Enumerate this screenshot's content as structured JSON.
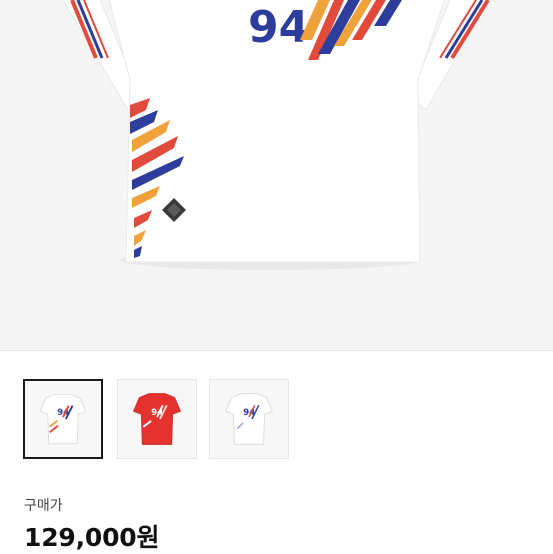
{
  "hero": {
    "jersey_number": "94",
    "background_color": "#f5f5f5",
    "jersey_color": "#ffffff",
    "number_color": "#2d3d9c",
    "accent_colors": [
      "#e24a3b",
      "#2d3d9c",
      "#f0a23a"
    ]
  },
  "thumbnails": [
    {
      "jersey_color": "#ffffff",
      "number": "94",
      "selected": true
    },
    {
      "jersey_color": "#e5322f",
      "number": "94",
      "selected": false
    },
    {
      "jersey_color": "#ffffff",
      "number": "94",
      "selected": false
    }
  ],
  "price": {
    "label": "구매가",
    "value": "129,000원"
  }
}
